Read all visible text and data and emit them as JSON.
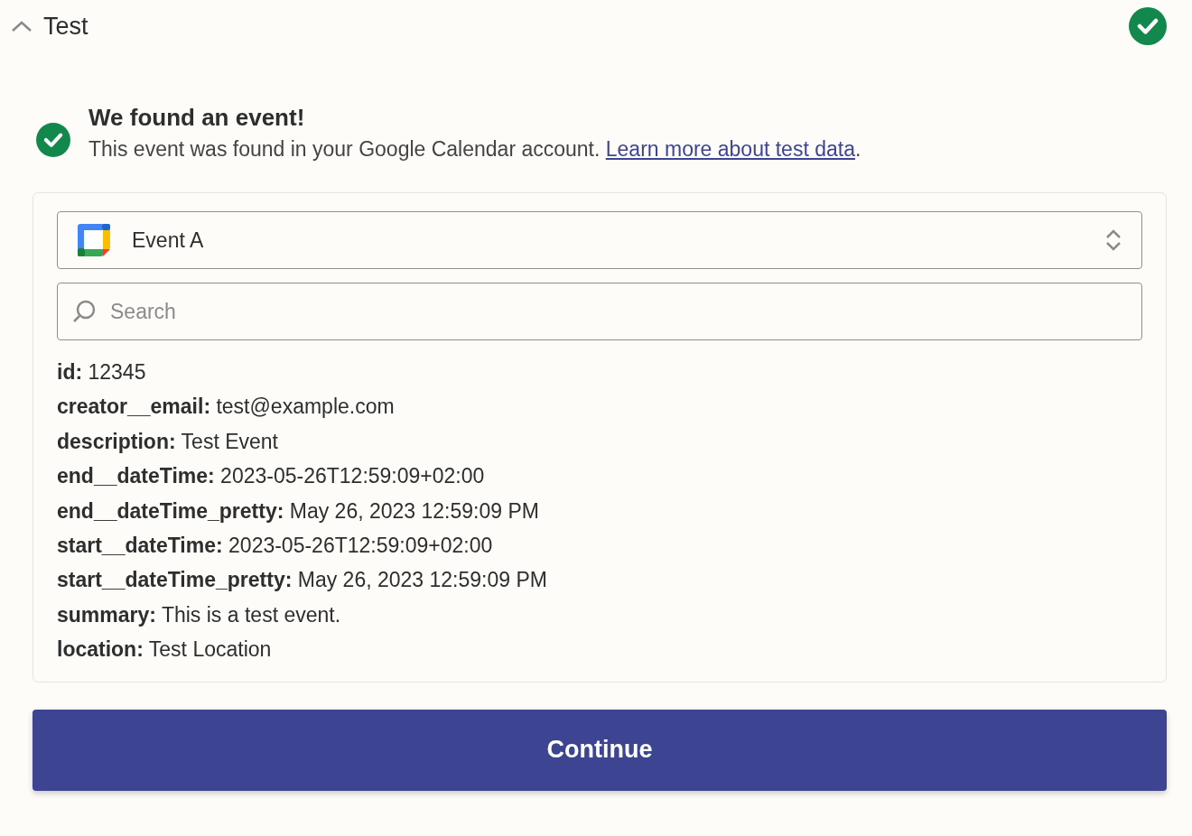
{
  "section": {
    "title": "Test",
    "expanded": true,
    "complete": true
  },
  "notice": {
    "heading": "We found an event!",
    "text": "This event was found in your Google Calendar account. ",
    "link": "Learn more about test data",
    "after": "."
  },
  "select": {
    "value": "Event A"
  },
  "search": {
    "placeholder": "Search"
  },
  "fields": [
    {
      "key": "id:",
      "value": "12345"
    },
    {
      "key": "creator__email:",
      "value": "test@example.com"
    },
    {
      "key": "description:",
      "value": "Test Event"
    },
    {
      "key": "end__dateTime:",
      "value": "2023-05-26T12:59:09+02:00"
    },
    {
      "key": "end__dateTime_pretty:",
      "value": "May 26, 2023 12:59:09 PM"
    },
    {
      "key": "start__dateTime:",
      "value": "2023-05-26T12:59:09+02:00"
    },
    {
      "key": "start__dateTime_pretty:",
      "value": "May 26, 2023 12:59:09 PM"
    },
    {
      "key": "summary:",
      "value": "This is a test event."
    },
    {
      "key": "location:",
      "value": "Test Location"
    }
  ],
  "button": {
    "label": "Continue"
  }
}
